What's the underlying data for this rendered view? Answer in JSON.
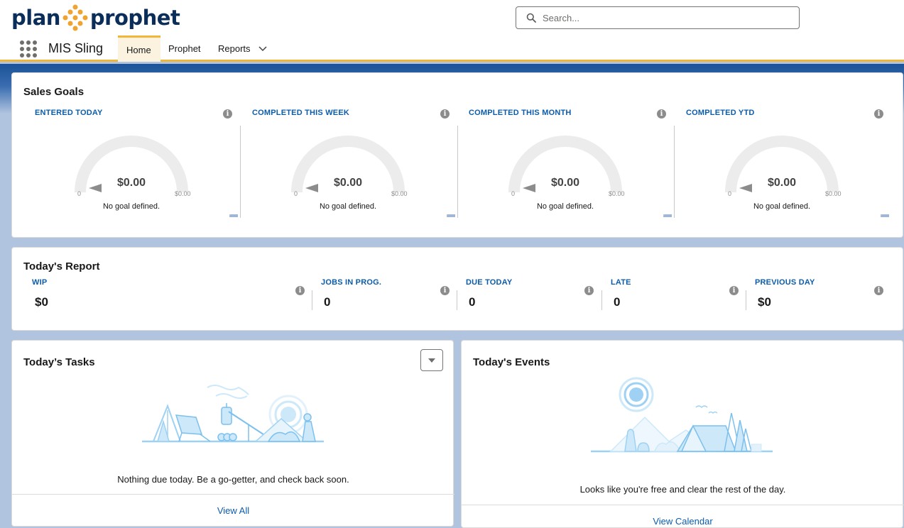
{
  "brand": {
    "logo_left": "plan",
    "logo_right": "prophet",
    "accent": "#f0a430",
    "navy": "#0b2d5a"
  },
  "search": {
    "placeholder": "Search..."
  },
  "nav": {
    "app_name": "MIS Sling",
    "tabs": [
      {
        "label": "Home",
        "active": true
      },
      {
        "label": "Prophet",
        "active": false
      },
      {
        "label": "Reports",
        "active": false,
        "has_menu": true
      }
    ]
  },
  "sales_goals": {
    "title": "Sales Goals",
    "metrics": [
      {
        "label": "ENTERED TODAY",
        "value": "$0.00",
        "min": "0",
        "max": "$0.00",
        "note": "No goal defined."
      },
      {
        "label": "COMPLETED THIS WEEK",
        "value": "$0.00",
        "min": "0",
        "max": "$0.00",
        "note": "No goal defined."
      },
      {
        "label": "COMPLETED THIS MONTH",
        "value": "$0.00",
        "min": "0",
        "max": "$0.00",
        "note": "No goal defined."
      },
      {
        "label": "COMPLETED YTD",
        "value": "$0.00",
        "min": "0",
        "max": "$0.00",
        "note": "No goal defined."
      }
    ]
  },
  "todays_report": {
    "title": "Today's Report",
    "metrics": [
      {
        "label": "WIP",
        "value": "$0"
      },
      {
        "label": "JOBS IN PROG.",
        "value": "0"
      },
      {
        "label": "DUE TODAY",
        "value": "0"
      },
      {
        "label": "LATE",
        "value": "0"
      },
      {
        "label": "PREVIOUS DAY",
        "value": "$0"
      }
    ]
  },
  "tasks": {
    "title": "Today’s Tasks",
    "empty_message": "Nothing due today. Be a go-getter, and check back soon.",
    "footer_link": "View All"
  },
  "events": {
    "title": "Today's Events",
    "empty_message": "Looks like you're free and clear the rest of the day.",
    "footer_link": "View Calendar"
  },
  "icons": {
    "search": "search-icon",
    "app_launcher": "app-launcher-icon",
    "info": "info-icon",
    "chevron": "chevron-down-icon"
  }
}
